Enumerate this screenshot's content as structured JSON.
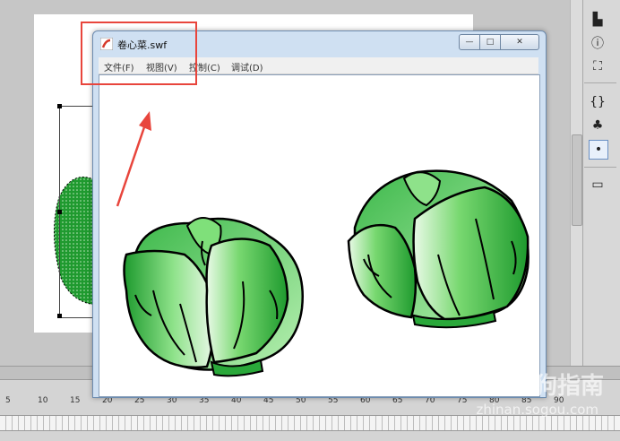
{
  "window": {
    "title": "卷心菜.swf",
    "btn_min": "—",
    "btn_max": "□",
    "btn_close": "✕"
  },
  "menu": [
    "文件(F)",
    "视图(V)",
    "控制(C)",
    "调试(D)"
  ],
  "ruler": [
    "5",
    "10",
    "15",
    "20",
    "25",
    "30",
    "35",
    "40",
    "45",
    "50",
    "55",
    "60",
    "65",
    "70",
    "75",
    "80",
    "85",
    "90"
  ],
  "watermark": {
    "brand": "搜狗指南",
    "url": "zhinan.sogou.com"
  },
  "tools": [
    "align-icon",
    "info-icon",
    "transform-icon",
    "code-icon",
    "components-icon",
    "motion-icon",
    "library-icon"
  ],
  "colors": {
    "annotation": "#e8453c",
    "cabbage_dark": "#1e9a2e",
    "cabbage_light": "#a6ef9c"
  }
}
